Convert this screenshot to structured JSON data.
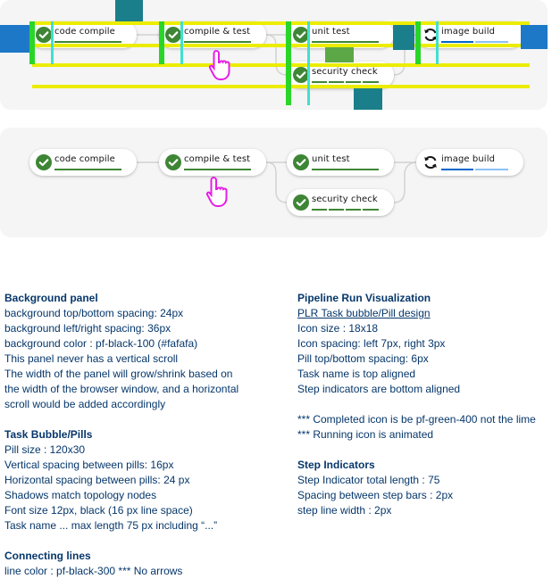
{
  "colors": {
    "panel": "#f5f5f5",
    "line": "#d2d2d2",
    "success": "#3e8635",
    "running": "#151515",
    "step_done": "#3e8635",
    "step_running": "#0066cc",
    "step_pending": "#8bc1f7",
    "overlay_yellow": "#ecec00",
    "overlay_green": "#2ad52a",
    "overlay_cyan": "#40e0d0",
    "overlay_teal": "#1a7f8a",
    "overlay_blue": "#1e78c8",
    "overlay_olive": "#5ca847",
    "spec_text": "#06376b"
  },
  "tasks": {
    "code_compile": "code compile",
    "compile_test": "compile & test",
    "unit_test": "unit test",
    "security_check": "security check",
    "image_build": "image build"
  },
  "icons": {
    "success": "check-circle-icon",
    "running": "sync-icon",
    "cursor": "pointer-hand-icon"
  },
  "spec_left": [
    {
      "t": "Background panel",
      "h": true
    },
    {
      "t": "background top/bottom spacing: 24px"
    },
    {
      "t": "background left/right spacing: 36px"
    },
    {
      "t": "background color : pf-black-100 (#fafafa)"
    },
    {
      "t": "This panel never has a vertical scroll"
    },
    {
      "t": "The width of the panel will grow/shrink based on"
    },
    {
      "t": "the width of the browser window, and a horizontal"
    },
    {
      "t": "scroll would be added accordingly"
    },
    {
      "t": ""
    },
    {
      "t": "Task Bubble/Pills",
      "h": true
    },
    {
      "t": "Pill size : 120x30"
    },
    {
      "t": "Vertical spacing between pills: 16px"
    },
    {
      "t": "Horizontal spacing between pills: 24 px"
    },
    {
      "t": "Shadows match topology nodes"
    },
    {
      "t": "Font size 12px, black (16 px line space)"
    },
    {
      "t": "Task name ... max length 75 px including “...”"
    },
    {
      "t": ""
    },
    {
      "t": "Connecting lines",
      "h": true
    },
    {
      "t": "line color : pf-black-300 *** No arrows"
    }
  ],
  "spec_right": [
    {
      "t": "Pipeline Run Visualization",
      "h": true
    },
    {
      "t": "PLR Task bubble/Pill design",
      "u": true
    },
    {
      "t": "Icon size : 18x18"
    },
    {
      "t": "Icon spacing: left 7px, right 3px"
    },
    {
      "t": "Pill top/bottom spacing: 6px"
    },
    {
      "t": "Task name is top aligned"
    },
    {
      "t": "Step indicators are bottom aligned"
    },
    {
      "t": ""
    },
    {
      "t": "*** Completed icon is be pf-green-400 not the lime"
    },
    {
      "t": "*** Running icon is animated"
    },
    {
      "t": ""
    },
    {
      "t": "Step Indicators",
      "h": true
    },
    {
      "t": "Step Indicator total length : 75"
    },
    {
      "t": "Spacing between step bars : 2px"
    },
    {
      "t": "step line width : 2px"
    }
  ]
}
